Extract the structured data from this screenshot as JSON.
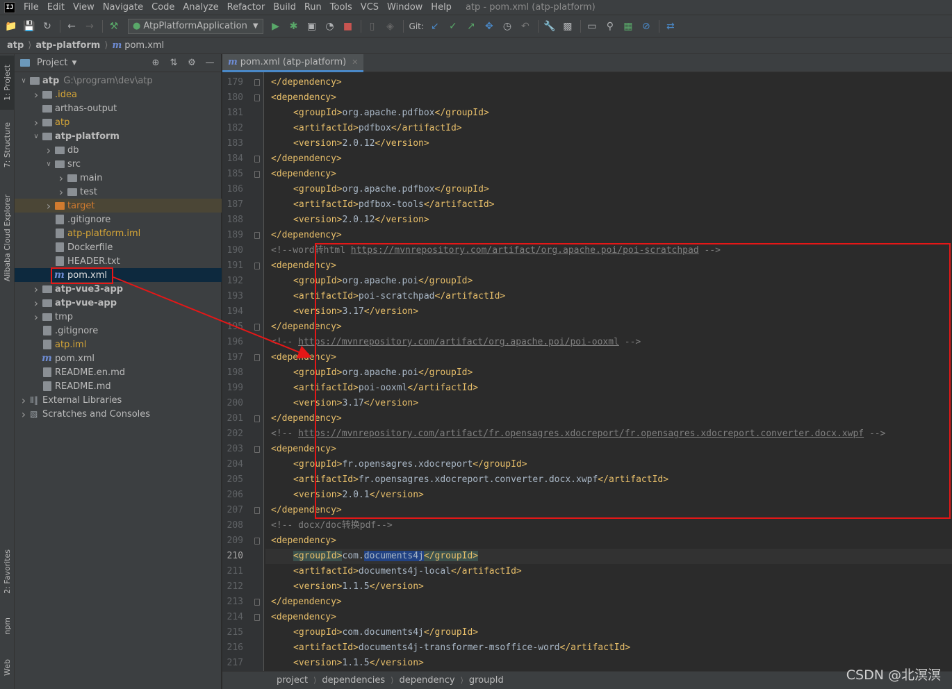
{
  "menubar": {
    "app_icon": "IJ",
    "items": [
      "File",
      "Edit",
      "View",
      "Navigate",
      "Code",
      "Analyze",
      "Refactor",
      "Build",
      "Run",
      "Tools",
      "VCS",
      "Window",
      "Help"
    ],
    "window_title": "atp - pom.xml (atp-platform)"
  },
  "toolbar": {
    "run_config": "AtpPlatformApplication",
    "git_label": "Git:",
    "icons": [
      "open-folder-icon",
      "save-icon",
      "sync-icon",
      "back-icon",
      "forward-icon",
      "build-hammer-icon",
      "run-icon",
      "debug-icon",
      "coverage-icon",
      "profile-icon",
      "stop-icon",
      "attach-icon",
      "git-update-icon",
      "git-commit-icon",
      "git-push-icon",
      "git-fetch-icon",
      "history-icon",
      "rollback-icon",
      "settings-wrench-icon",
      "project-structure-icon",
      "terminal-icon",
      "search-icon",
      "database-icon",
      "block-icon",
      "cloud-icon"
    ]
  },
  "nav": {
    "crumbs": [
      "atp",
      "atp-platform",
      "pom.xml"
    ]
  },
  "leftstrip": {
    "tabs": [
      "1: Project",
      "7: Structure",
      "Alibaba Cloud Explorer",
      "2: Favorites",
      "npm",
      "Web"
    ]
  },
  "project": {
    "title": "Project",
    "tree": [
      {
        "label": "atp",
        "extra": "G:\\program\\dev\\atp",
        "depth": 0,
        "arrow": "open",
        "icon": "module",
        "style": "bold"
      },
      {
        "label": ".idea",
        "depth": 1,
        "arrow": "closed",
        "icon": "folder",
        "style": "yellow"
      },
      {
        "label": "arthas-output",
        "depth": 1,
        "arrow": "none",
        "icon": "folder",
        "style": ""
      },
      {
        "label": "atp",
        "depth": 1,
        "arrow": "closed",
        "icon": "folder",
        "style": "yellow"
      },
      {
        "label": "atp-platform",
        "depth": 1,
        "arrow": "open",
        "icon": "module",
        "style": "bold"
      },
      {
        "label": "db",
        "depth": 2,
        "arrow": "closed",
        "icon": "folder",
        "style": ""
      },
      {
        "label": "src",
        "depth": 2,
        "arrow": "open",
        "icon": "folder",
        "style": ""
      },
      {
        "label": "main",
        "depth": 3,
        "arrow": "closed",
        "icon": "folder",
        "style": ""
      },
      {
        "label": "test",
        "depth": 3,
        "arrow": "closed",
        "icon": "folder",
        "style": ""
      },
      {
        "label": "target",
        "depth": 2,
        "arrow": "closed",
        "icon": "folder-orange",
        "style": "orange",
        "row": "excluded"
      },
      {
        "label": ".gitignore",
        "depth": 2,
        "arrow": "none",
        "icon": "file",
        "style": ""
      },
      {
        "label": "atp-platform.iml",
        "depth": 2,
        "arrow": "none",
        "icon": "file",
        "style": "yellow"
      },
      {
        "label": "Dockerfile",
        "depth": 2,
        "arrow": "none",
        "icon": "file",
        "style": ""
      },
      {
        "label": "HEADER.txt",
        "depth": 2,
        "arrow": "none",
        "icon": "file",
        "style": ""
      },
      {
        "label": "pom.xml",
        "depth": 2,
        "arrow": "none",
        "icon": "maven",
        "style": "white",
        "row": "selected"
      },
      {
        "label": "atp-vue3-app",
        "depth": 1,
        "arrow": "closed",
        "icon": "module",
        "style": "bold"
      },
      {
        "label": "atp-vue-app",
        "depth": 1,
        "arrow": "closed",
        "icon": "module",
        "style": "bold"
      },
      {
        "label": "tmp",
        "depth": 1,
        "arrow": "closed",
        "icon": "folder",
        "style": ""
      },
      {
        "label": ".gitignore",
        "depth": 1,
        "arrow": "none",
        "icon": "file",
        "style": ""
      },
      {
        "label": "atp.iml",
        "depth": 1,
        "arrow": "none",
        "icon": "file",
        "style": "yellow"
      },
      {
        "label": "pom.xml",
        "depth": 1,
        "arrow": "none",
        "icon": "maven",
        "style": ""
      },
      {
        "label": "README.en.md",
        "depth": 1,
        "arrow": "none",
        "icon": "file",
        "style": ""
      },
      {
        "label": "README.md",
        "depth": 1,
        "arrow": "none",
        "icon": "file",
        "style": ""
      },
      {
        "label": "External Libraries",
        "depth": 0,
        "arrow": "closed",
        "icon": "library",
        "style": ""
      },
      {
        "label": "Scratches and Consoles",
        "depth": 0,
        "arrow": "closed",
        "icon": "scratch",
        "style": ""
      }
    ]
  },
  "editor": {
    "tab": "pom.xml (atp-platform)",
    "current_line": 210,
    "lines": [
      {
        "n": "179",
        "indent": 2,
        "parts": [
          [
            "t",
            "</dependency>"
          ]
        ]
      },
      {
        "n": "180",
        "indent": 2,
        "parts": [
          [
            "t",
            "<dependency>"
          ]
        ]
      },
      {
        "n": "181",
        "indent": 3,
        "parts": [
          [
            "t",
            "<groupId>"
          ],
          [
            "txt",
            "org.apache.pdfbox"
          ],
          [
            "t",
            "</groupId>"
          ]
        ]
      },
      {
        "n": "182",
        "indent": 3,
        "parts": [
          [
            "t",
            "<artifactId>"
          ],
          [
            "txt",
            "pdfbox"
          ],
          [
            "t",
            "</artifactId>"
          ]
        ]
      },
      {
        "n": "183",
        "indent": 3,
        "parts": [
          [
            "t",
            "<version>"
          ],
          [
            "txt",
            "2.0.12"
          ],
          [
            "t",
            "</version>"
          ]
        ]
      },
      {
        "n": "184",
        "indent": 2,
        "parts": [
          [
            "t",
            "</dependency>"
          ]
        ]
      },
      {
        "n": "185",
        "indent": 2,
        "parts": [
          [
            "t",
            "<dependency>"
          ]
        ]
      },
      {
        "n": "186",
        "indent": 3,
        "parts": [
          [
            "t",
            "<groupId>"
          ],
          [
            "txt",
            "org.apache.pdfbox"
          ],
          [
            "t",
            "</groupId>"
          ]
        ]
      },
      {
        "n": "187",
        "indent": 3,
        "parts": [
          [
            "t",
            "<artifactId>"
          ],
          [
            "txt",
            "pdfbox-tools"
          ],
          [
            "t",
            "</artifactId>"
          ]
        ]
      },
      {
        "n": "188",
        "indent": 3,
        "parts": [
          [
            "t",
            "<version>"
          ],
          [
            "txt",
            "2.0.12"
          ],
          [
            "t",
            "</version>"
          ]
        ]
      },
      {
        "n": "189",
        "indent": 2,
        "parts": [
          [
            "t",
            "</dependency>"
          ]
        ]
      },
      {
        "n": "190",
        "indent": 2,
        "parts": [
          [
            "cm",
            "<!--word转html "
          ],
          [
            "url",
            "https://mvnrepository.com/artifact/org.apache.poi/poi-scratchpad"
          ],
          [
            "cm",
            " -->"
          ]
        ]
      },
      {
        "n": "191",
        "indent": 2,
        "parts": [
          [
            "t",
            "<dependency>"
          ]
        ]
      },
      {
        "n": "192",
        "indent": 3,
        "parts": [
          [
            "t",
            "<groupId>"
          ],
          [
            "txt",
            "org.apache.poi"
          ],
          [
            "t",
            "</groupId>"
          ]
        ]
      },
      {
        "n": "193",
        "indent": 3,
        "parts": [
          [
            "t",
            "<artifactId>"
          ],
          [
            "txt",
            "poi-scratchpad"
          ],
          [
            "t",
            "</artifactId>"
          ]
        ]
      },
      {
        "n": "194",
        "indent": 3,
        "parts": [
          [
            "t",
            "<version>"
          ],
          [
            "txt",
            "3.17"
          ],
          [
            "t",
            "</version>"
          ]
        ]
      },
      {
        "n": "195",
        "indent": 2,
        "parts": [
          [
            "t",
            "</dependency>"
          ]
        ]
      },
      {
        "n": "196",
        "indent": 2,
        "parts": [
          [
            "cm",
            "<!-- "
          ],
          [
            "url",
            "https://mvnrepository.com/artifact/org.apache.poi/poi-ooxml"
          ],
          [
            "cm",
            " -->"
          ]
        ]
      },
      {
        "n": "197",
        "indent": 2,
        "parts": [
          [
            "t",
            "<dependency>"
          ]
        ]
      },
      {
        "n": "198",
        "indent": 3,
        "parts": [
          [
            "t",
            "<groupId>"
          ],
          [
            "txt",
            "org.apache.poi"
          ],
          [
            "t",
            "</groupId>"
          ]
        ]
      },
      {
        "n": "199",
        "indent": 3,
        "parts": [
          [
            "t",
            "<artifactId>"
          ],
          [
            "txt",
            "poi-ooxml"
          ],
          [
            "t",
            "</artifactId>"
          ]
        ]
      },
      {
        "n": "200",
        "indent": 3,
        "parts": [
          [
            "t",
            "<version>"
          ],
          [
            "txt",
            "3.17"
          ],
          [
            "t",
            "</version>"
          ]
        ]
      },
      {
        "n": "201",
        "indent": 2,
        "parts": [
          [
            "t",
            "</dependency>"
          ]
        ]
      },
      {
        "n": "202",
        "indent": 2,
        "parts": [
          [
            "cm",
            "<!-- "
          ],
          [
            "url",
            "https://mvnrepository.com/artifact/fr.opensagres.xdocreport/fr.opensagres.xdocreport.converter.docx.xwpf"
          ],
          [
            "cm",
            " -->"
          ]
        ]
      },
      {
        "n": "203",
        "indent": 2,
        "parts": [
          [
            "t",
            "<dependency>"
          ]
        ]
      },
      {
        "n": "204",
        "indent": 3,
        "parts": [
          [
            "t",
            "<groupId>"
          ],
          [
            "txt",
            "fr.opensagres.xdocreport"
          ],
          [
            "t",
            "</groupId>"
          ]
        ]
      },
      {
        "n": "205",
        "indent": 3,
        "parts": [
          [
            "t",
            "<artifactId>"
          ],
          [
            "txt",
            "fr.opensagres.xdocreport.converter.docx.xwpf"
          ],
          [
            "t",
            "</artifactId>"
          ]
        ]
      },
      {
        "n": "206",
        "indent": 3,
        "parts": [
          [
            "t",
            "<version>"
          ],
          [
            "txt",
            "2.0.1"
          ],
          [
            "t",
            "</version>"
          ]
        ]
      },
      {
        "n": "207",
        "indent": 2,
        "parts": [
          [
            "t",
            "</dependency>"
          ]
        ]
      },
      {
        "n": "208",
        "indent": 2,
        "parts": [
          [
            "cm",
            "<!-- docx/doc转换pdf-->"
          ]
        ]
      },
      {
        "n": "209",
        "indent": 2,
        "parts": [
          [
            "t",
            "<dependency>"
          ]
        ]
      },
      {
        "n": "210",
        "indent": 3,
        "parts": [
          [
            "t hlt",
            "<groupId>"
          ],
          [
            "txt",
            "com."
          ],
          [
            "txt hl",
            "documents4j"
          ],
          [
            "t hlt",
            "</groupId>"
          ]
        ]
      },
      {
        "n": "211",
        "indent": 3,
        "parts": [
          [
            "t",
            "<artifactId>"
          ],
          [
            "txt",
            "documents4j-local"
          ],
          [
            "t",
            "</artifactId>"
          ]
        ]
      },
      {
        "n": "212",
        "indent": 3,
        "parts": [
          [
            "t",
            "<version>"
          ],
          [
            "txt",
            "1.1.5"
          ],
          [
            "t",
            "</version>"
          ]
        ]
      },
      {
        "n": "213",
        "indent": 2,
        "parts": [
          [
            "t",
            "</dependency>"
          ]
        ]
      },
      {
        "n": "214",
        "indent": 2,
        "parts": [
          [
            "t",
            "<dependency>"
          ]
        ]
      },
      {
        "n": "215",
        "indent": 3,
        "parts": [
          [
            "t",
            "<groupId>"
          ],
          [
            "txt",
            "com.documents4j"
          ],
          [
            "t",
            "</groupId>"
          ]
        ]
      },
      {
        "n": "216",
        "indent": 3,
        "parts": [
          [
            "t",
            "<artifactId>"
          ],
          [
            "txt",
            "documents4j-transformer-msoffice-word"
          ],
          [
            "t",
            "</artifactId>"
          ]
        ]
      },
      {
        "n": "217",
        "indent": 3,
        "parts": [
          [
            "t",
            "<version>"
          ],
          [
            "txt",
            "1.1.5"
          ],
          [
            "t",
            "</version>"
          ]
        ]
      }
    ]
  },
  "statusbar": {
    "crumbs": [
      "project",
      "dependencies",
      "dependency",
      "groupId"
    ]
  },
  "watermark": "CSDN @北溟溟",
  "colors": {
    "annotation_red": "#e51717",
    "xml_tag": "#e8bf6a",
    "xml_text": "#a9b7c6",
    "comment": "#808080",
    "selection": "#0d293e"
  }
}
